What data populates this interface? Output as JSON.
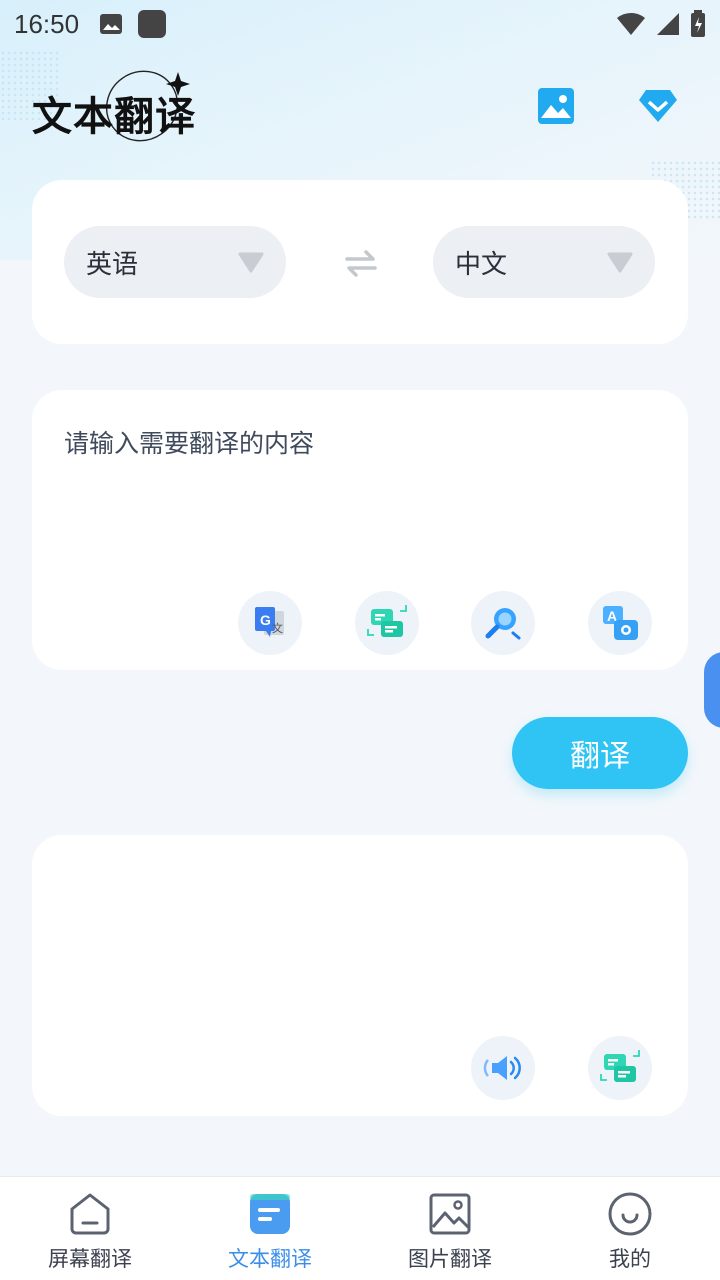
{
  "status_bar": {
    "time": "16:50"
  },
  "header": {
    "title": "文本翻译"
  },
  "languages": {
    "source": "英语",
    "target": "中文"
  },
  "input": {
    "placeholder": "请输入需要翻译的内容"
  },
  "actions": {
    "translate_label": "翻译"
  },
  "bottom_nav": {
    "items": [
      {
        "label": "屏幕翻译",
        "icon": "screen-icon"
      },
      {
        "label": "文本翻译",
        "icon": "text-doc-icon",
        "active": true
      },
      {
        "label": "图片翻译",
        "icon": "picture-icon"
      },
      {
        "label": "我的",
        "icon": "smile-face-icon"
      }
    ]
  },
  "colors": {
    "accent": "#30c4f5",
    "active_nav": "#3a8ee8",
    "background": "#f3f7fb"
  }
}
